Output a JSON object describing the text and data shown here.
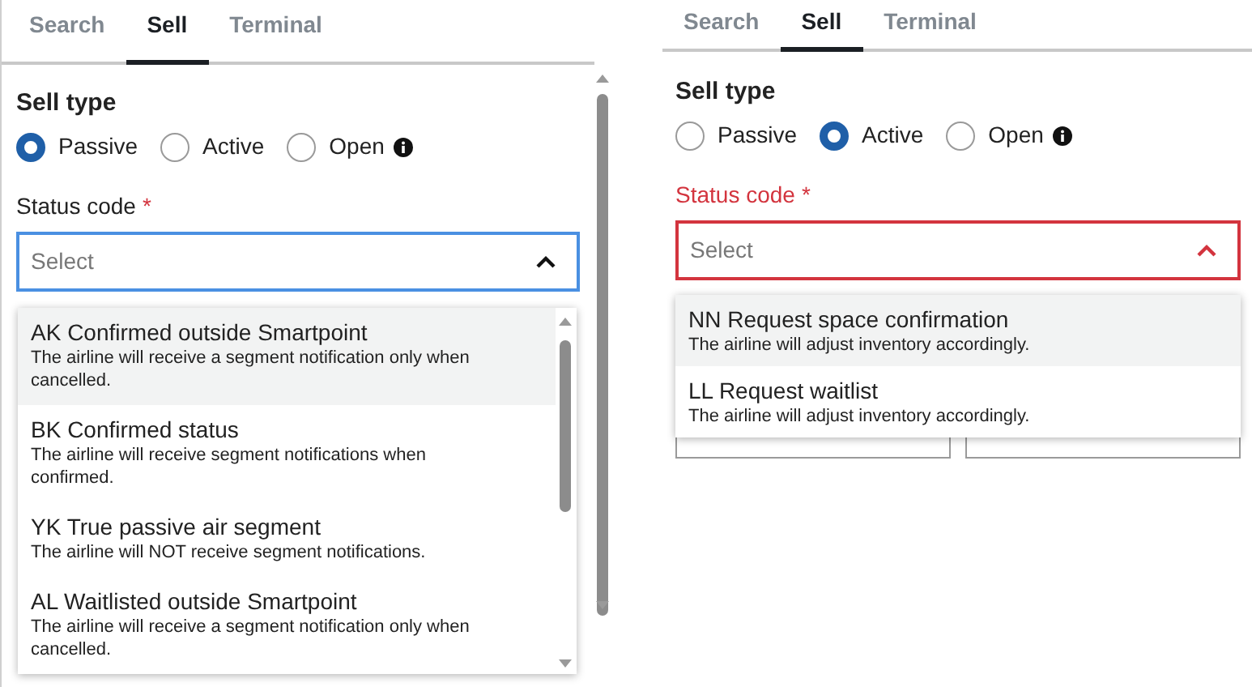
{
  "panels": [
    {
      "tabs": [
        {
          "label": "Search",
          "selected": false
        },
        {
          "label": "Sell",
          "selected": true
        },
        {
          "label": "Terminal",
          "selected": false
        }
      ],
      "sell_type": {
        "label": "Sell type",
        "options": [
          {
            "label": "Passive",
            "selected": true,
            "info": false
          },
          {
            "label": "Active",
            "selected": false,
            "info": false
          },
          {
            "label": "Open",
            "selected": false,
            "info": true
          }
        ]
      },
      "status_code": {
        "label": "Status code",
        "required_mark": "*",
        "error": false,
        "placeholder": "Select",
        "scrollable": true,
        "options": [
          {
            "title": "AK Confirmed outside Smartpoint",
            "description": "The airline will receive a segment notification only when cancelled.",
            "highlighted": true
          },
          {
            "title": "BK Confirmed status",
            "description": "The airline will receive segment notifications when confirmed.",
            "highlighted": false
          },
          {
            "title": "YK True passive air segment",
            "description": "The airline will NOT receive segment notifications.",
            "highlighted": false
          },
          {
            "title": "AL Waitlisted outside Smartpoint",
            "description": "The airline will receive a segment notification only when cancelled.",
            "highlighted": false
          }
        ]
      }
    },
    {
      "tabs": [
        {
          "label": "Search",
          "selected": false
        },
        {
          "label": "Sell",
          "selected": true
        },
        {
          "label": "Terminal",
          "selected": false
        }
      ],
      "sell_type": {
        "label": "Sell type",
        "options": [
          {
            "label": "Passive",
            "selected": false,
            "info": false
          },
          {
            "label": "Active",
            "selected": true,
            "info": false
          },
          {
            "label": "Open",
            "selected": false,
            "info": true
          }
        ]
      },
      "status_code": {
        "label": "Status code",
        "required_mark": "*",
        "error": true,
        "placeholder": "Select",
        "scrollable": false,
        "options": [
          {
            "title": "NN Request space confirmation",
            "description": "The airline will adjust inventory accordingly.",
            "highlighted": true
          },
          {
            "title": "LL Request waitlist",
            "description": "The airline will adjust inventory accordingly.",
            "highlighted": false
          }
        ]
      }
    }
  ]
}
